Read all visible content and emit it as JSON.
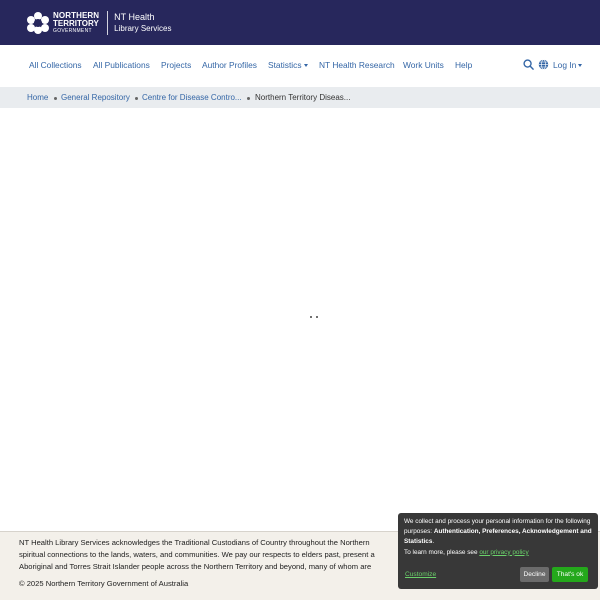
{
  "header": {
    "gov_logo": {
      "line1": "NORTHERN",
      "line2": "TERRITORY",
      "line3": "GOVERNMENT"
    },
    "site_title_1": "NT Health",
    "site_title_2": "Library Services"
  },
  "nav": {
    "items": [
      {
        "label": "All Collections"
      },
      {
        "label": "All Publications"
      },
      {
        "label": "Projects"
      },
      {
        "label": "Author Profiles"
      },
      {
        "label": "Statistics"
      },
      {
        "label": "NT Health Research"
      },
      {
        "label": "Work Units"
      },
      {
        "label": "Help"
      }
    ],
    "login_label": "Log In"
  },
  "breadcrumb": {
    "items": [
      {
        "label": "Home"
      },
      {
        "label": "General Repository"
      },
      {
        "label": "Centre for Disease Contro..."
      },
      {
        "label": "Northern Territory Diseas..."
      }
    ]
  },
  "footer": {
    "ack_line1": "NT Health Library Services acknowledges the Traditional Custodians of Country throughout the Northern",
    "ack_line2": "spiritual connections to the lands, waters, and communities. We pay our respects to elders past, present a",
    "ack_line3": "Aboriginal and Torres Strait Islander people across the Northern Territory and beyond, many of whom are",
    "copyright": "© 2025 Northern Territory Government of Australia"
  },
  "cookie": {
    "text_start": "We collect and process your personal information for the following purposes: ",
    "purposes": "Authentication, Preferences, Acknowledgement and Statistics",
    "text_end": ".",
    "learn_more": "To learn more, please see ",
    "privacy_link": "our privacy policy",
    "customize_label": "Customize",
    "decline_label": "Decline",
    "accept_label": "That's ok"
  },
  "colors": {
    "header_bg": "#27275c",
    "link": "#3466a6",
    "breadcrumb_bg": "#e9ecef",
    "footer_bg": "#f3f0ea",
    "cookie_bg": "#383838",
    "accept_green": "#24a81b"
  }
}
